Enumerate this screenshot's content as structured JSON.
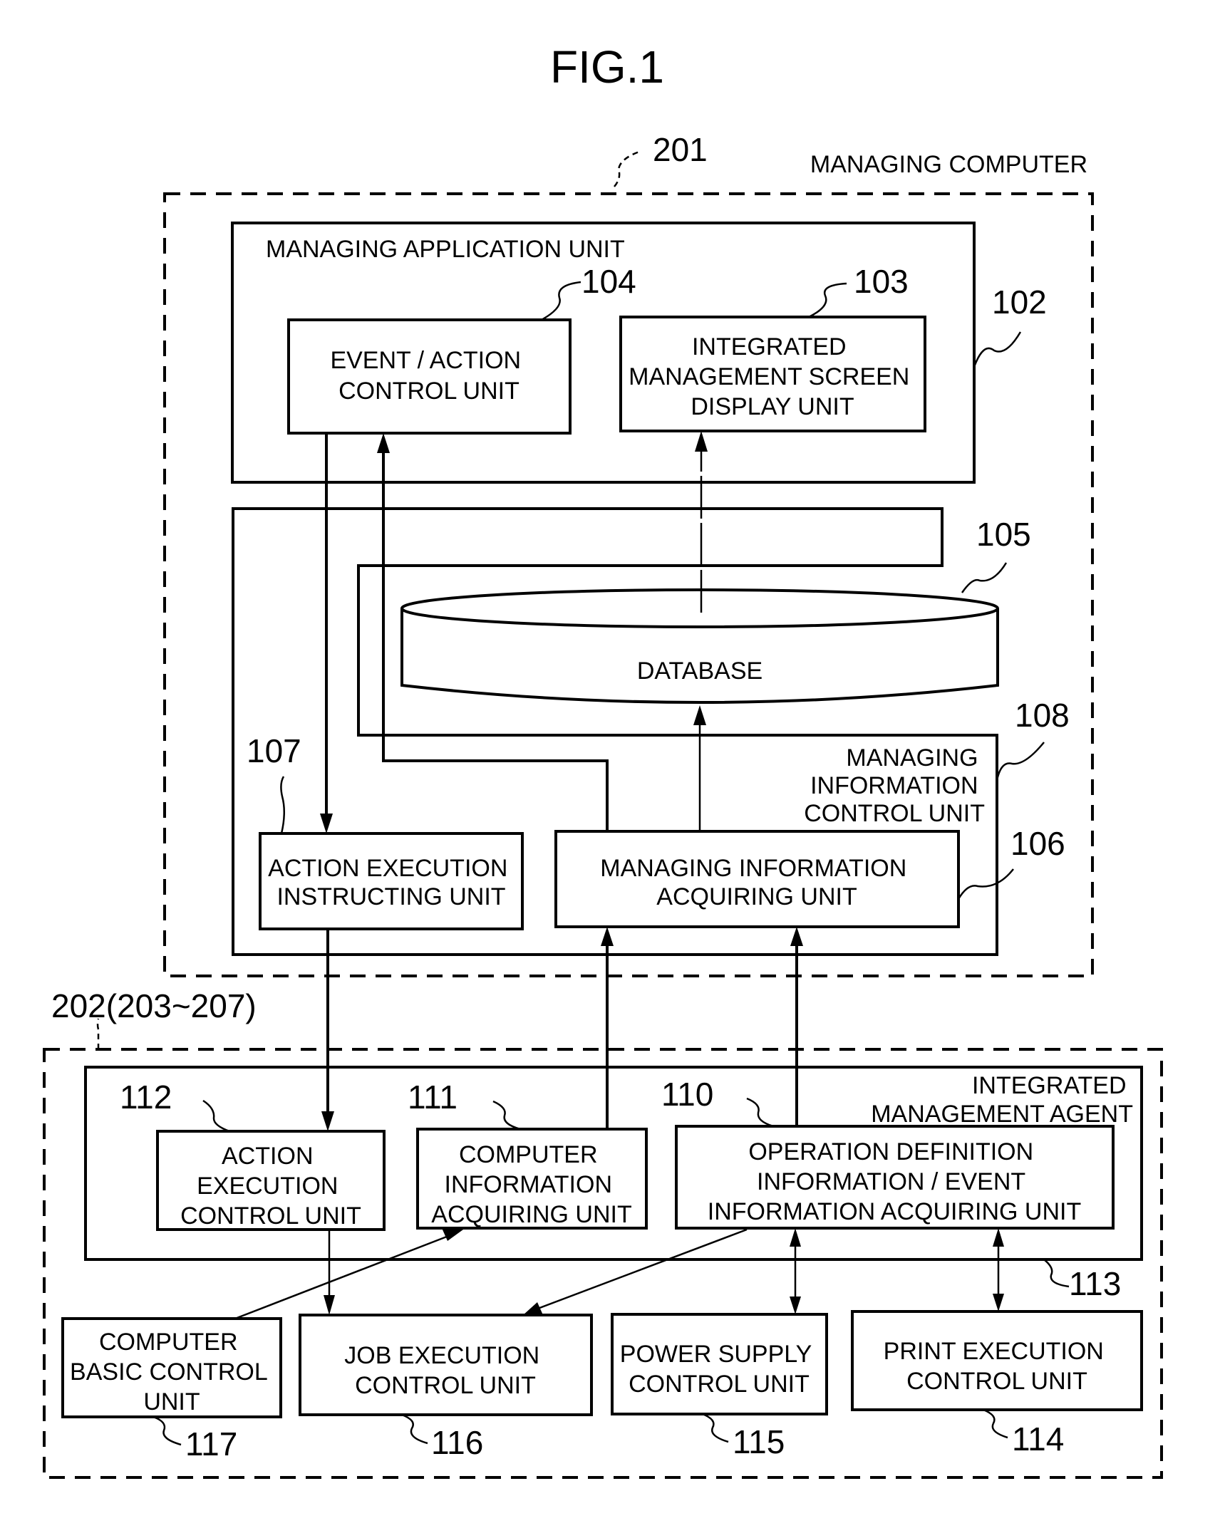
{
  "figure": {
    "title": "FIG.1"
  },
  "managing_computer": {
    "ref": "201",
    "label": "MANAGING COMPUTER",
    "managing_application_unit": {
      "ref": "102",
      "label": "MANAGING APPLICATION UNIT",
      "event_action_control_unit": {
        "ref": "104",
        "lines": [
          "EVENT / ACTION",
          "CONTROL UNIT"
        ]
      },
      "integrated_screen_display_unit": {
        "ref": "103",
        "lines": [
          "INTEGRATED",
          "MANAGEMENT SCREEN",
          "DISPLAY UNIT"
        ]
      }
    },
    "managing_information_control_unit": {
      "ref": "108",
      "lines": [
        "MANAGING",
        "INFORMATION",
        "CONTROL UNIT"
      ],
      "database": {
        "ref": "105",
        "label": "DATABASE"
      },
      "action_execution_instructing_unit": {
        "ref": "107",
        "lines": [
          "ACTION EXECUTION",
          "INSTRUCTING UNIT"
        ]
      },
      "managing_information_acquiring_unit": {
        "ref": "106",
        "lines": [
          "MANAGING INFORMATION",
          "ACQUIRING UNIT"
        ]
      }
    }
  },
  "managed_computer": {
    "ref": "202(203~207)",
    "integrated_management_agent": {
      "ref": "113",
      "lines": [
        "INTEGRATED",
        "MANAGEMENT AGENT"
      ],
      "action_execution_control_unit": {
        "ref": "112",
        "lines": [
          "ACTION",
          "EXECUTION",
          "CONTROL UNIT"
        ]
      },
      "computer_information_acquiring_unit": {
        "ref": "111",
        "lines": [
          "COMPUTER",
          "INFORMATION",
          "ACQUIRING UNIT"
        ]
      },
      "operation_definition_unit": {
        "ref": "110",
        "lines": [
          "OPERATION DEFINITION",
          "INFORMATION / EVENT",
          "INFORMATION ACQUIRING UNIT"
        ]
      }
    },
    "computer_basic_control_unit": {
      "ref": "117",
      "lines": [
        "COMPUTER",
        "BASIC CONTROL",
        "UNIT"
      ]
    },
    "job_execution_control_unit": {
      "ref": "116",
      "lines": [
        "JOB EXECUTION",
        "CONTROL UNIT"
      ]
    },
    "power_supply_control_unit": {
      "ref": "115",
      "lines": [
        "POWER SUPPLY",
        "CONTROL UNIT"
      ]
    },
    "print_execution_control_unit": {
      "ref": "114",
      "lines": [
        "PRINT EXECUTION",
        "CONTROL UNIT"
      ]
    }
  }
}
